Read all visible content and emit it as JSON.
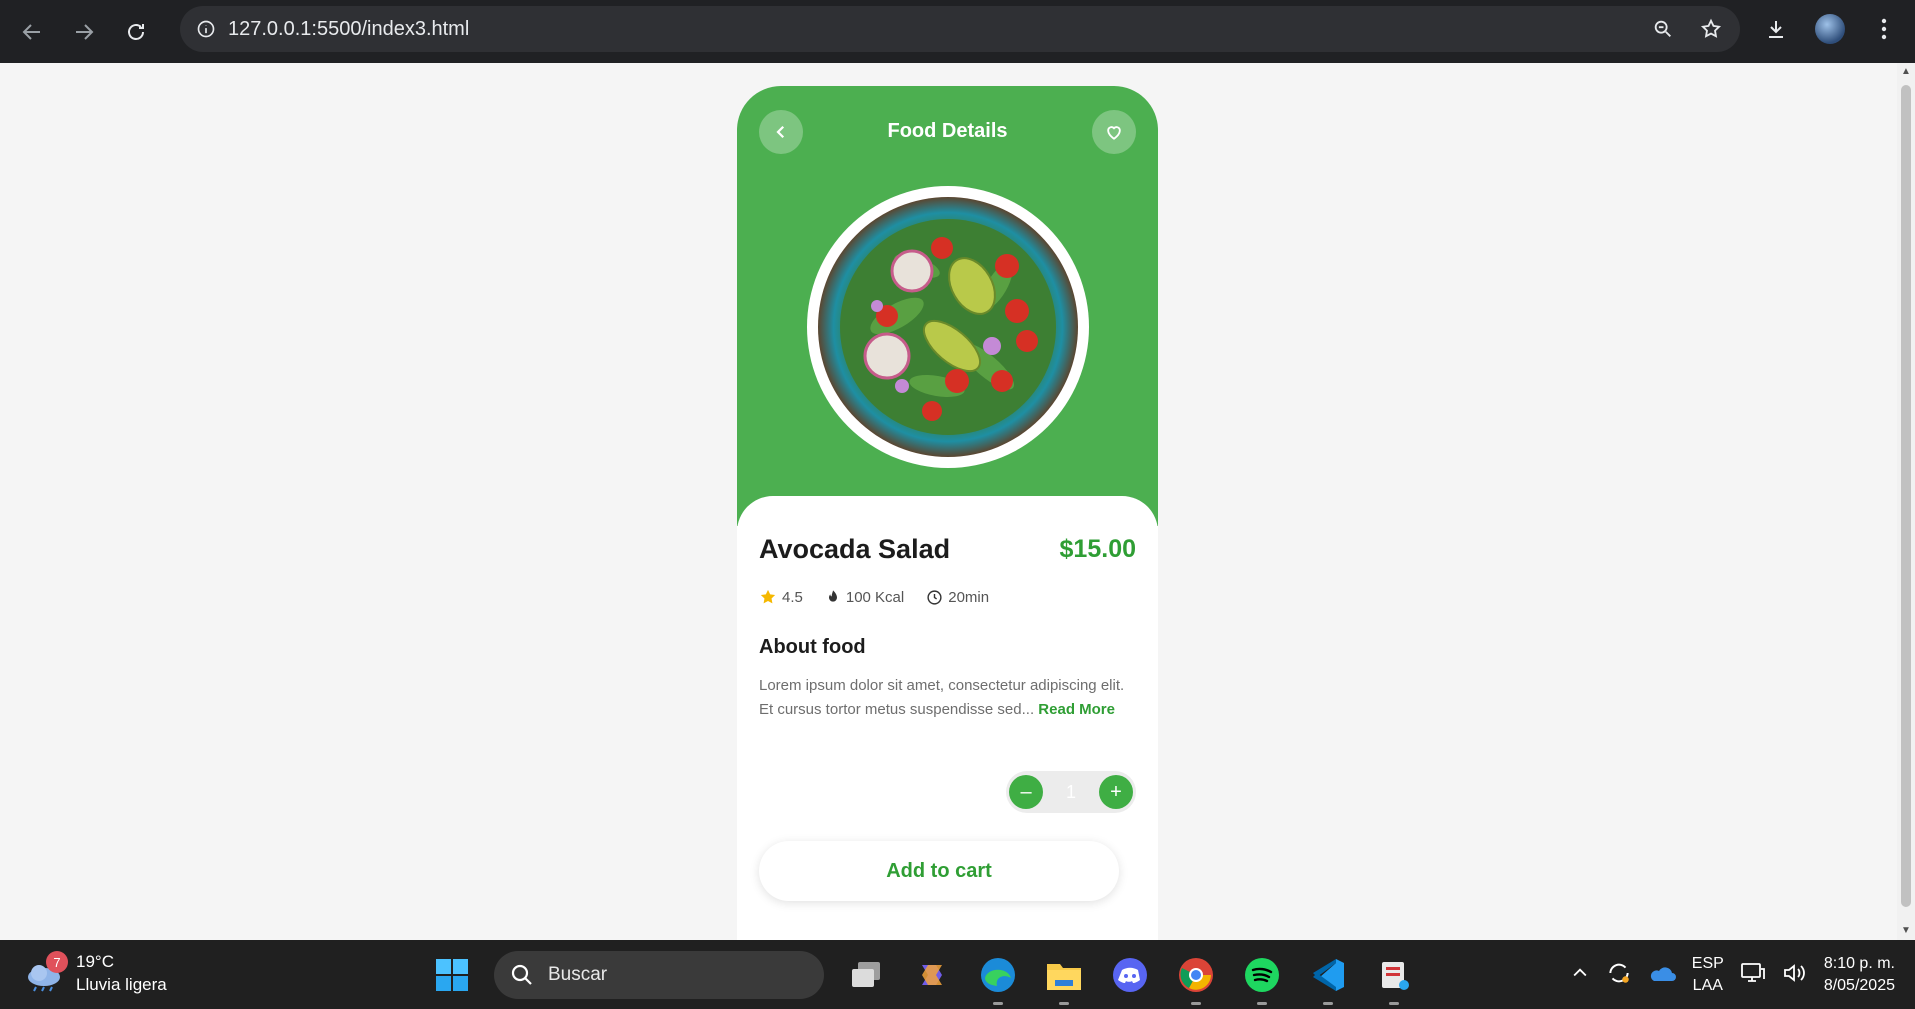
{
  "browser": {
    "url": "127.0.0.1:5500/index3.html"
  },
  "screen": {
    "header_title": "Food Details",
    "food_name": "Avocada Salad",
    "price": "$15.00",
    "rating": "4.5",
    "calories": "100 Kcal",
    "time": "20min",
    "about_title": "About food",
    "description": "Lorem ipsum dolor sit amet, consectetur adipiscing elit. Et cursus tortor metus suspendisse sed...",
    "read_more": "Read More",
    "quantity": "1",
    "minus_label": "–",
    "plus_label": "+",
    "add_to_cart": "Add to cart",
    "accent_color": "#4caf50"
  },
  "taskbar": {
    "weather_badge": "7",
    "temperature": "19°C",
    "weather_desc": "Lluvia ligera",
    "search_placeholder": "Buscar",
    "lang_primary": "ESP",
    "lang_secondary": "LAA",
    "time": "8:10 p. m.",
    "date": "8/05/2025"
  }
}
